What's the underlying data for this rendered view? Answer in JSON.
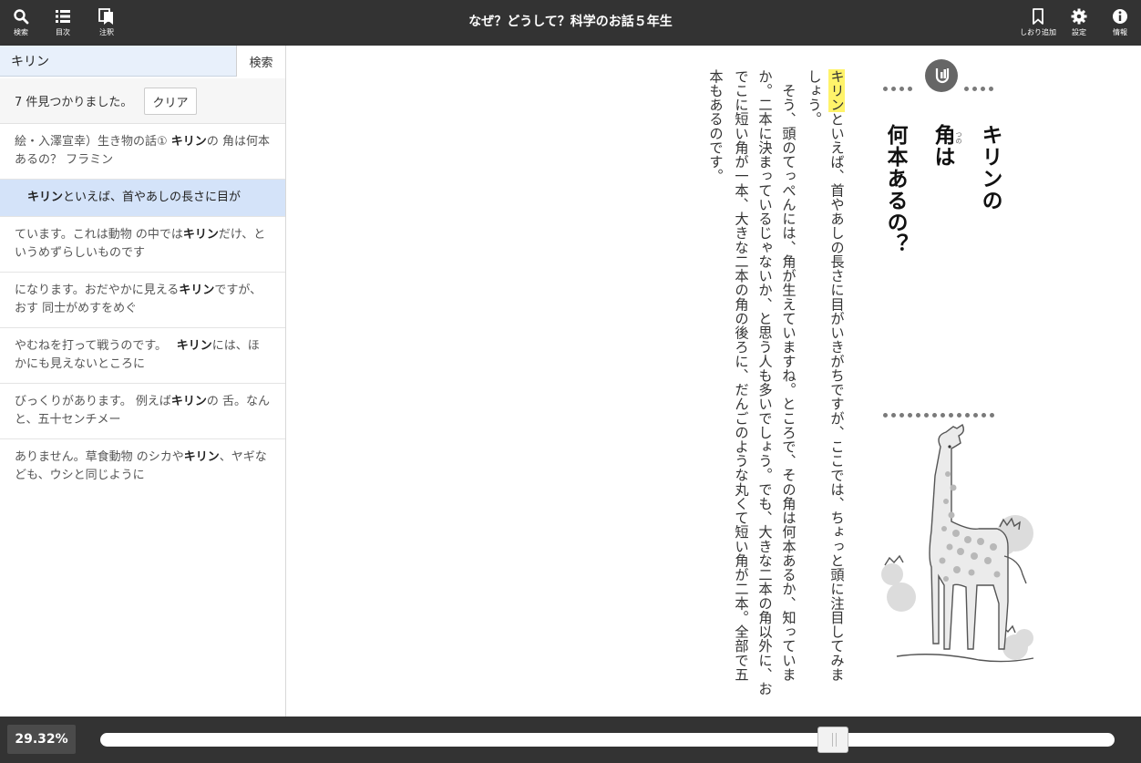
{
  "toolbar": {
    "title": "なぜ？どうして？科学のお話５年生",
    "left_buttons": [
      {
        "label": "検索",
        "icon": "search-icon"
      },
      {
        "label": "目次",
        "icon": "list-icon"
      },
      {
        "label": "注釈",
        "icon": "annotation-icon"
      }
    ],
    "right_buttons": [
      {
        "label": "しおり追加",
        "icon": "bookmark-icon"
      },
      {
        "label": "設定",
        "icon": "gear-icon"
      },
      {
        "label": "情報",
        "icon": "info-icon"
      }
    ]
  },
  "search": {
    "query": "キリン",
    "button_label": "検索",
    "result_count": "7 件見つかりました。",
    "clear_label": "クリア",
    "results": [
      {
        "before": "絵・入澤宣幸）生き物の話① ",
        "match": "キリン",
        "after": "の 角は何本あるの？ フラミン",
        "selected": false
      },
      {
        "before": "",
        "match": "キリン",
        "after": "といえば、首やあしの長さに目が",
        "selected": true
      },
      {
        "before": "ています。これは動物 の中では",
        "match": "キリン",
        "after": "だけ、というめずらしいものです",
        "selected": false
      },
      {
        "before": "になります。おだやかに見える",
        "match": "キリン",
        "after": "ですが、おす 同士がめすをめぐ",
        "selected": false
      },
      {
        "before": "やむねを打って戦うのです。　 ",
        "match": "キリン",
        "after": "には、ほかにも見えないところに",
        "selected": false
      },
      {
        "before": "びっくりがあります。 例えば",
        "match": "キリン",
        "after": "の 舌。なんと、五十センチメー",
        "selected": false
      },
      {
        "before": "ありません。草食動物 のシカや",
        "match": "キリン",
        "after": "、ヤギなども、ウシと同じように",
        "selected": false
      }
    ]
  },
  "page": {
    "heading_lines": [
      "キリンの",
      "角は",
      "何本あるの？"
    ],
    "heading_ruby": "つの",
    "body_columns": [
      {
        "hl": "キリン",
        "text": "といえば、首やあしの長さに目がいきがちですが、ここでは、ちょっと頭に注目してみま"
      },
      {
        "hl": "",
        "text": "しょう。"
      },
      {
        "hl": "",
        "text": "　そう、頭のてっぺんには、角が生えていますね。ところで、その角は何本あるか、知っていま"
      },
      {
        "hl": "",
        "text": "か。二本に決まっているじゃないか、と思う人も多いでしょう。でも、大きな二本の角以外に、お"
      },
      {
        "hl": "",
        "text": "でこに短い角が一本、大きな二本の角の後ろに、だんごのような丸くて短い角が二本。全部で五"
      },
      {
        "hl": "",
        "text": "本もあるのです。"
      }
    ]
  },
  "progress": {
    "percent_label": "29.32%",
    "value": 0.7228
  },
  "colors": {
    "toolbar_bg": "#333333",
    "search_bg": "#e8f0fb",
    "selected_bg": "#d4e3f9",
    "highlight": "#fff36a"
  }
}
